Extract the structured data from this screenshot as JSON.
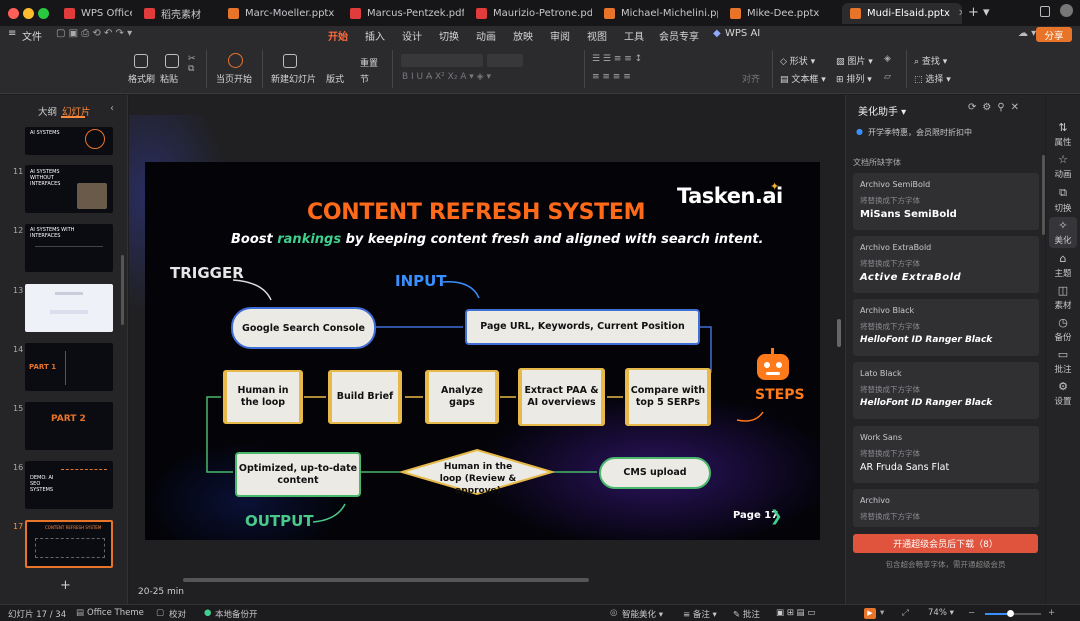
{
  "tabs": [
    {
      "label": "WPS Office",
      "color": "#e23b3b"
    },
    {
      "label": "稻壳素材",
      "color": "#e23b3b"
    },
    {
      "label": "Marc-Moeller.pptx",
      "color": "#e8742a"
    },
    {
      "label": "Marcus-Pentzek.pdf",
      "color": "#e23b3b"
    },
    {
      "label": "Maurizio-Petrone.pdf",
      "color": "#e23b3b"
    },
    {
      "label": "Michael-Michelini.pptx",
      "color": "#e8742a"
    },
    {
      "label": "Mike-Dee.pptx",
      "color": "#e8742a"
    },
    {
      "label": "Mudi-Elsaid.pptx",
      "color": "#e8742a"
    }
  ],
  "menu": {
    "file": "文件",
    "items": [
      "开始",
      "插入",
      "设计",
      "切换",
      "动画",
      "放映",
      "审阅",
      "视图",
      "工具",
      "会员专享"
    ],
    "wps_ai": "WPS AI",
    "share": "分享"
  },
  "ribbon": {
    "format_painter": "格式刷",
    "paste": "粘贴",
    "from_current": "当页开始",
    "new_slide": "新建幻灯片",
    "layout": "版式",
    "section": "节",
    "reset": "重置",
    "align": "对齐",
    "shape": "形状",
    "textbox": "文本框",
    "picture": "图片",
    "arrange": "排列",
    "fill": "填充",
    "find": "查找",
    "select": "选择"
  },
  "left_panel": {
    "tab_outline": "大纲",
    "tab_slides": "幻灯片",
    "thumbs": [
      {
        "num": "",
        "title": "AI SYSTEMS"
      },
      {
        "num": "11",
        "title": "AI SYSTEMS WITHOUT INTERFACES"
      },
      {
        "num": "12",
        "title": "AI SYSTEMS WITH INTERFACES"
      },
      {
        "num": "13",
        "title": ""
      },
      {
        "num": "14",
        "title": "PART 1"
      },
      {
        "num": "15",
        "title": "PART 2"
      },
      {
        "num": "16",
        "title": "DEMO: AI SEO SYSTEMS"
      },
      {
        "num": "17",
        "title": "CONTENT REFRESH SYSTEM"
      }
    ]
  },
  "slide": {
    "logo": "Tasken.ai",
    "title": "CONTENT REFRESH SYSTEM",
    "subtitle_pre": "Boost ",
    "subtitle_hl": "rankings",
    "subtitle_post": " by keeping content fresh and aligned with search intent.",
    "trigger": "TRIGGER",
    "input": "INPUT",
    "steps": "STEPS",
    "output": "OUTPUT",
    "gsc": "Google Search Console",
    "page_input": "Page URL, Keywords, Current Position",
    "human_loop": "Human in the loop",
    "build_brief": "Build Brief",
    "analyze": "Analyze gaps",
    "extract": "Extract PAA & AI overviews",
    "compare": "Compare with top 5 SERPs",
    "optimized": "Optimized, up-to-date content",
    "review": "Human in the loop (Review & approve)",
    "cms": "CMS upload",
    "page": "Page 17"
  },
  "notes": "20-25 min",
  "right_panel": {
    "title": "美化助手",
    "promo": "开学季特惠，会员限时折扣中",
    "section": "文档所缺字体",
    "fonts": [
      {
        "name": "Archivo SemiBold",
        "hint": "将替换成下方字体",
        "replacement": "MiSans SemiBold"
      },
      {
        "name": "Archivo ExtraBold",
        "hint": "将替换成下方字体",
        "replacement": "Active ExtraBold"
      },
      {
        "name": "Archivo Black",
        "hint": "将替换成下方字体",
        "replacement": "HelloFont ID Ranger Black"
      },
      {
        "name": "Lato Black",
        "hint": "将替换成下方字体",
        "replacement": "HelloFont ID Ranger Black"
      },
      {
        "name": "Work Sans",
        "hint": "将替换成下方字体",
        "replacement": "AR Fruda Sans Flat"
      },
      {
        "name": "Archivo",
        "hint": "将替换成下方字体",
        "replacement": ""
      }
    ],
    "download_button": "开通超级会员后下载（8）",
    "footnote": "包含超会畅享字体，需开通超级会员"
  },
  "side_tools": [
    "属性",
    "动画",
    "切换",
    "美化",
    "主题",
    "素材",
    "备份",
    "批注",
    "设置"
  ],
  "status": {
    "slide_count": "幻灯片 17 / 34",
    "theme": "Office Theme",
    "proof": "校对",
    "backup": "本地备份开",
    "beautify": "智能美化",
    "notes": "备注",
    "comments": "批注",
    "zoom": "74%"
  }
}
